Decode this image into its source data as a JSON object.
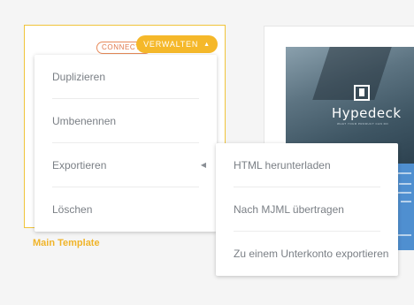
{
  "template_card": {
    "badge": "CONNECTED",
    "manage_label": "VERWALTEN",
    "manage_chevron": "▲",
    "name": "Main Template"
  },
  "preview_card": {
    "brand": "Hypedeck",
    "tagline": "WHAT YOUR PRODUCT CAN DO"
  },
  "context_menu": {
    "items": [
      {
        "label": "Duplizieren"
      },
      {
        "label": "Umbenennen"
      },
      {
        "label": "Exportieren",
        "submenu_caret": "◀"
      },
      {
        "label": "Löschen"
      }
    ]
  },
  "export_submenu": {
    "items": [
      {
        "label": "HTML herunterladen"
      },
      {
        "label": "Nach MJML übertragen"
      },
      {
        "label": "Zu einem Unterkonto exportieren"
      }
    ]
  },
  "colors": {
    "accent": "#f5b82a",
    "badge": "#e0784a",
    "menu_text": "#7a7f85"
  }
}
